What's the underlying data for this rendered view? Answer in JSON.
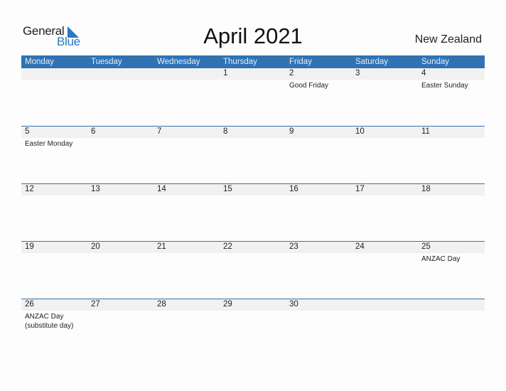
{
  "logo": {
    "general": "General",
    "blue": "Blue",
    "accent": "#2b78c5"
  },
  "title": "April 2021",
  "country": "New Zealand",
  "colors": {
    "header": "#2f73b3",
    "band": "#f1f1f1",
    "border": "#3a72a8"
  },
  "weekdays": [
    "Monday",
    "Tuesday",
    "Wednesday",
    "Thursday",
    "Friday",
    "Saturday",
    "Sunday"
  ],
  "weeks": [
    {
      "days": [
        {
          "num": "",
          "event": ""
        },
        {
          "num": "",
          "event": ""
        },
        {
          "num": "",
          "event": ""
        },
        {
          "num": "1",
          "event": ""
        },
        {
          "num": "2",
          "event": "Good Friday"
        },
        {
          "num": "3",
          "event": ""
        },
        {
          "num": "4",
          "event": "Easter Sunday"
        }
      ]
    },
    {
      "days": [
        {
          "num": "5",
          "event": "Easter Monday"
        },
        {
          "num": "6",
          "event": ""
        },
        {
          "num": "7",
          "event": ""
        },
        {
          "num": "8",
          "event": ""
        },
        {
          "num": "9",
          "event": ""
        },
        {
          "num": "10",
          "event": ""
        },
        {
          "num": "11",
          "event": ""
        }
      ]
    },
    {
      "days": [
        {
          "num": "12",
          "event": ""
        },
        {
          "num": "13",
          "event": ""
        },
        {
          "num": "14",
          "event": ""
        },
        {
          "num": "15",
          "event": ""
        },
        {
          "num": "16",
          "event": ""
        },
        {
          "num": "17",
          "event": ""
        },
        {
          "num": "18",
          "event": ""
        }
      ]
    },
    {
      "days": [
        {
          "num": "19",
          "event": ""
        },
        {
          "num": "20",
          "event": ""
        },
        {
          "num": "21",
          "event": ""
        },
        {
          "num": "22",
          "event": ""
        },
        {
          "num": "23",
          "event": ""
        },
        {
          "num": "24",
          "event": ""
        },
        {
          "num": "25",
          "event": "ANZAC Day"
        }
      ]
    },
    {
      "days": [
        {
          "num": "26",
          "event": "ANZAC Day (substitute day)"
        },
        {
          "num": "27",
          "event": ""
        },
        {
          "num": "28",
          "event": ""
        },
        {
          "num": "29",
          "event": ""
        },
        {
          "num": "30",
          "event": ""
        },
        {
          "num": "",
          "event": ""
        },
        {
          "num": "",
          "event": ""
        }
      ]
    }
  ]
}
